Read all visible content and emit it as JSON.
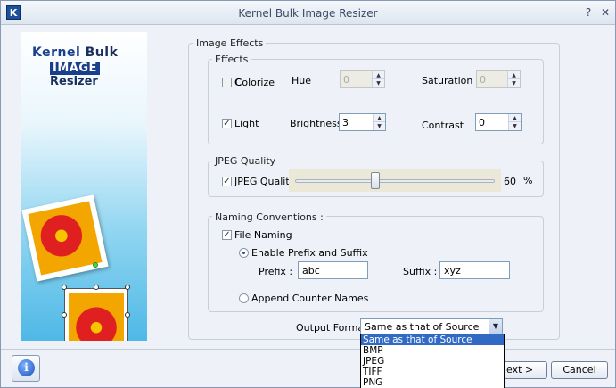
{
  "window": {
    "title": "Kernel Bulk Image Resizer",
    "app_icon": "K"
  },
  "banner": {
    "logo_kernel": "Kernel",
    "logo_bulk": "Bulk",
    "logo_image": "IMAGE",
    "logo_resizer": "Resizer"
  },
  "image_effects": {
    "title": "Image Effects",
    "effects": {
      "title": "Effects",
      "colorize": {
        "label": "Colorize",
        "checked": false
      },
      "hue": {
        "label": "Hue",
        "value": "0",
        "enabled": false
      },
      "saturation": {
        "label": "Saturation",
        "value": "0",
        "enabled": false
      },
      "light": {
        "label": "Light",
        "checked": true
      },
      "brightness": {
        "label": "Brightness",
        "value": "3"
      },
      "contrast": {
        "label": "Contrast",
        "value": "0"
      }
    },
    "jpeg": {
      "title": "JPEG Quality",
      "checkbox_label": "JPEG Quality :",
      "checked": true,
      "value": 60,
      "value_text": "60",
      "unit": "%"
    },
    "naming": {
      "title": "Naming Conventions :",
      "file_naming": {
        "label": "File Naming",
        "checked": true
      },
      "prefix_suffix": {
        "label": "Enable Prefix and Suffix",
        "selected": true
      },
      "prefix": {
        "label": "Prefix :",
        "value": "abc"
      },
      "suffix": {
        "label": "Suffix :",
        "value": "xyz"
      },
      "counter": {
        "label": "Append Counter Names",
        "selected": false
      }
    },
    "output_format": {
      "label": "Output Format :",
      "selected": "Same as that of Source",
      "options": [
        "Same as that of Source",
        "BMP",
        "JPEG",
        "TIFF",
        "PNG"
      ]
    }
  },
  "footer": {
    "next_label": "Next >",
    "cancel_label": "Cancel",
    "info_icon": "i"
  }
}
